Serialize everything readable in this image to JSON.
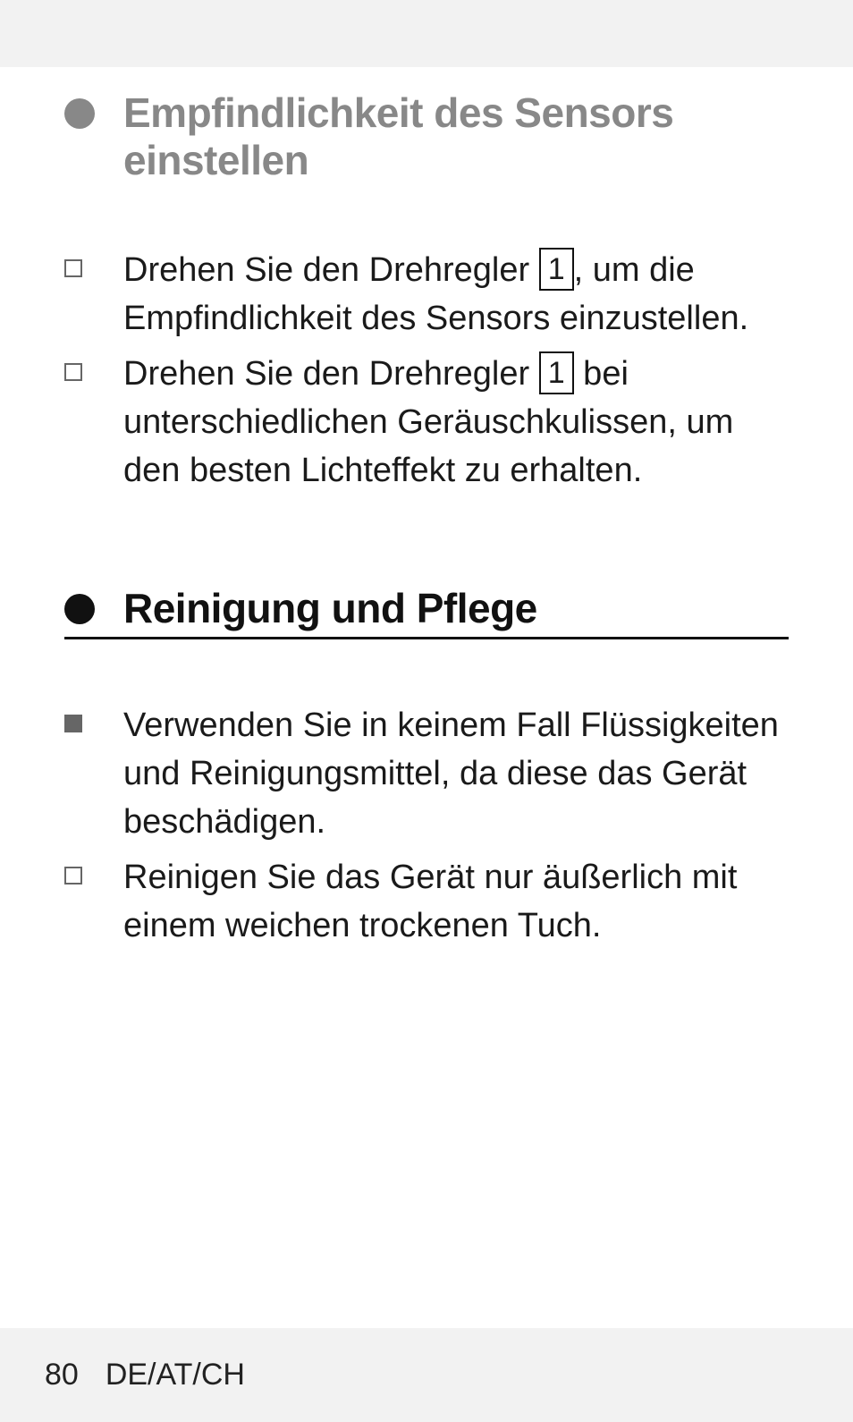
{
  "sections": [
    {
      "title": "Empfindlichkeit des Sensors einstellen",
      "style": "grey"
    },
    {
      "title": "Reinigung und Pflege",
      "style": "black-underline"
    }
  ],
  "items_a": [
    {
      "bullet": "outline",
      "pre": "Drehen Sie den Drehregler ",
      "ref": "1",
      "post": ", um die Empfindlichkeit des Sensors einzustellen."
    },
    {
      "bullet": "outline",
      "pre": "Drehen Sie den Drehregler ",
      "ref": "1",
      "post": " bei unterschiedlichen Geräusch­kulissen, um den besten Lichteffekt zu erhalten."
    }
  ],
  "items_b": [
    {
      "bullet": "fill",
      "text": "Verwenden Sie in keinem Fall Flüssigkeiten und Reinigungsmittel, da diese das Gerät beschädigen."
    },
    {
      "bullet": "outline",
      "text": "Reinigen Sie das Gerät nur äußer­lich mit einem weichen trockenen Tuch."
    }
  ],
  "footer": {
    "page": "80",
    "locale": "DE/AT/CH"
  }
}
